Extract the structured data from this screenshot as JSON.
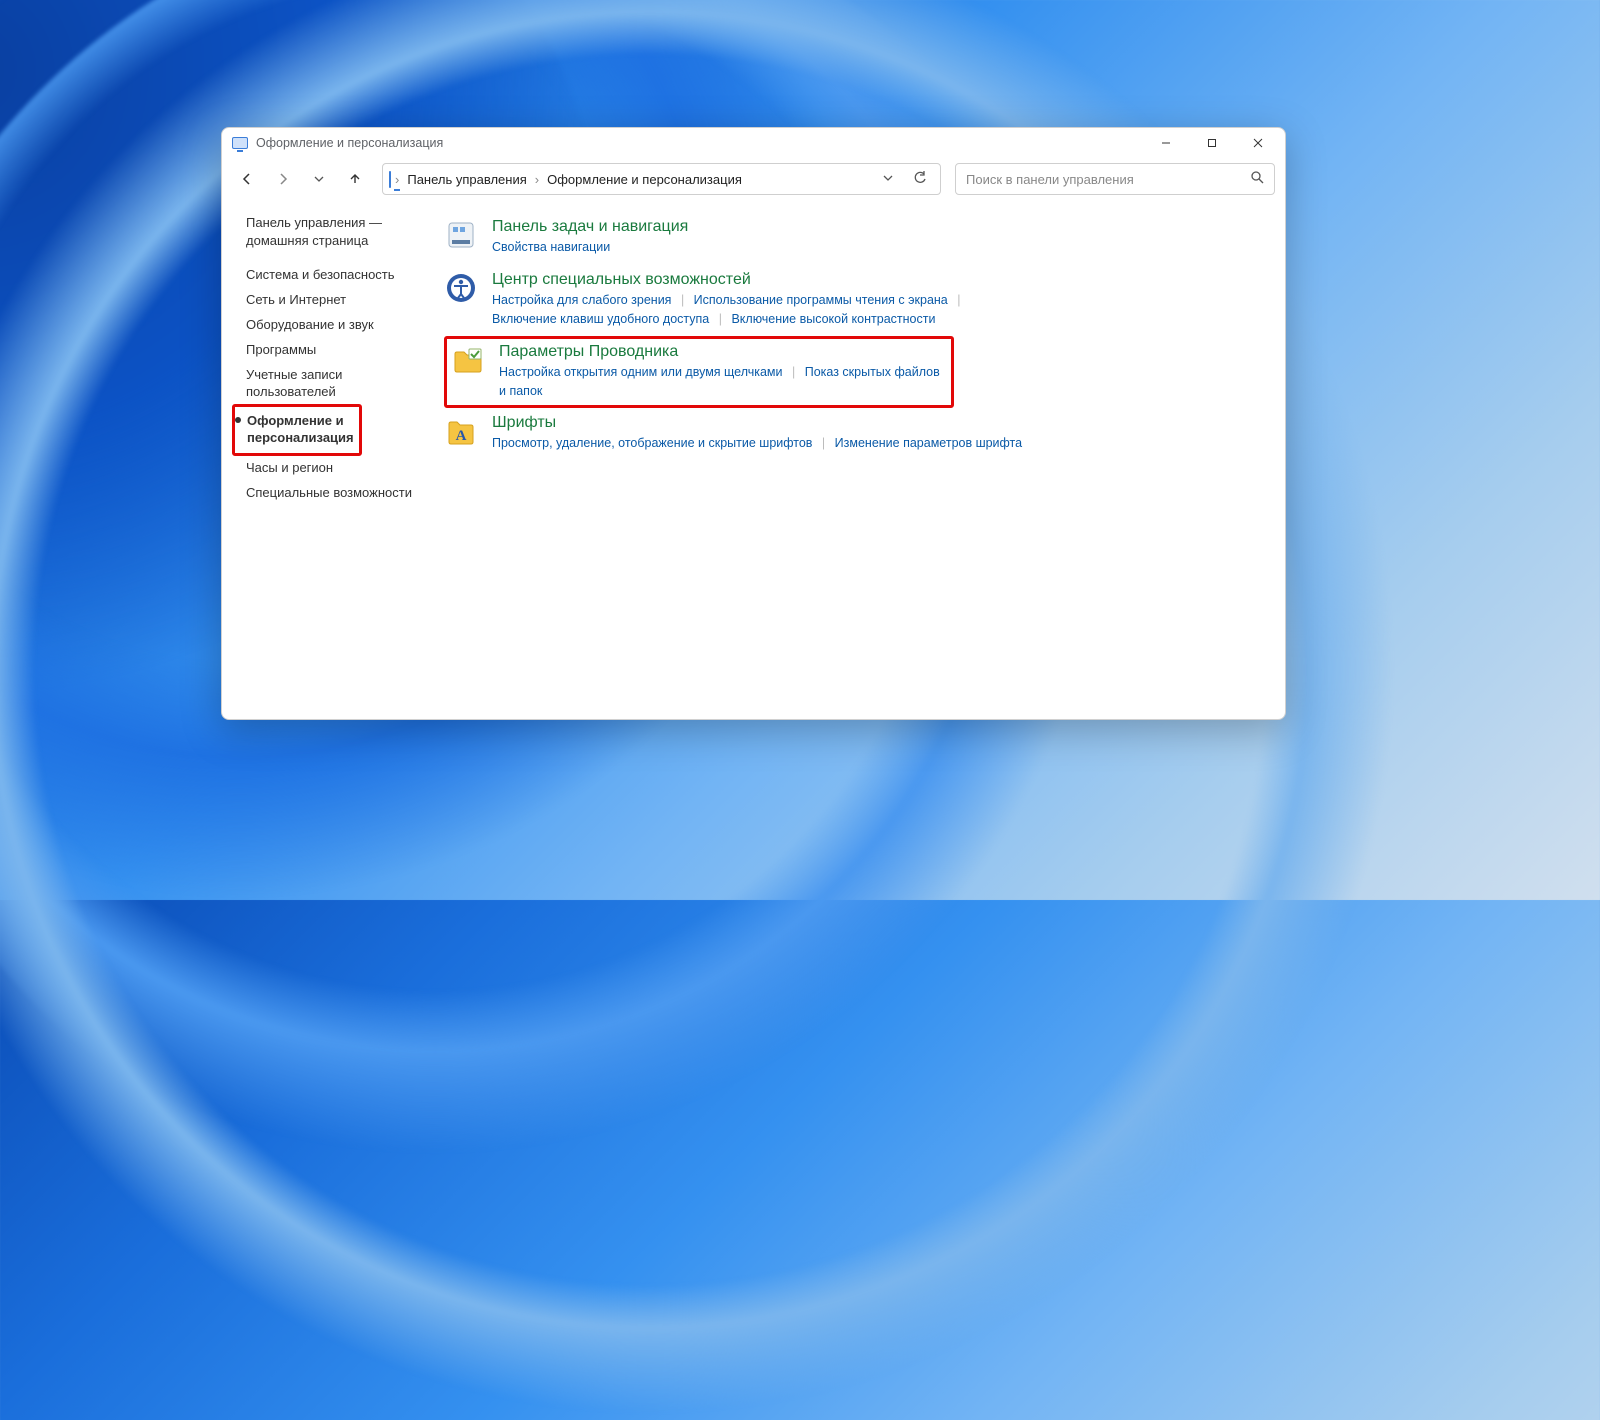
{
  "window": {
    "title": "Оформление и персонализация"
  },
  "breadcrumb": {
    "root": "Панель управления",
    "current": "Оформление и персонализация"
  },
  "search": {
    "placeholder": "Поиск в панели управления"
  },
  "sidebar": {
    "home_line1": "Панель управления —",
    "home_line2": "домашняя страница",
    "items": [
      "Система и безопасность",
      "Сеть и Интернет",
      "Оборудование и звук",
      "Программы",
      "Учетные записи пользователей",
      "Оформление и персонализация",
      "Часы и регион",
      "Специальные возможности"
    ],
    "selected_index": 5
  },
  "categories": [
    {
      "title": "Панель задач и навигация",
      "links": [
        "Свойства навигации"
      ]
    },
    {
      "title": "Центр специальных возможностей",
      "links": [
        "Настройка для слабого зрения",
        "Использование программы чтения с экрана",
        "Включение клавиш удобного доступа",
        "Включение высокой контрастности"
      ]
    },
    {
      "title": "Параметры Проводника",
      "links": [
        "Настройка открытия одним или двумя щелчками",
        "Показ скрытых файлов и папок"
      ],
      "highlighted": true
    },
    {
      "title": "Шрифты",
      "links": [
        "Просмотр, удаление, отображение и скрытие шрифтов",
        "Изменение параметров шрифта"
      ]
    }
  ]
}
